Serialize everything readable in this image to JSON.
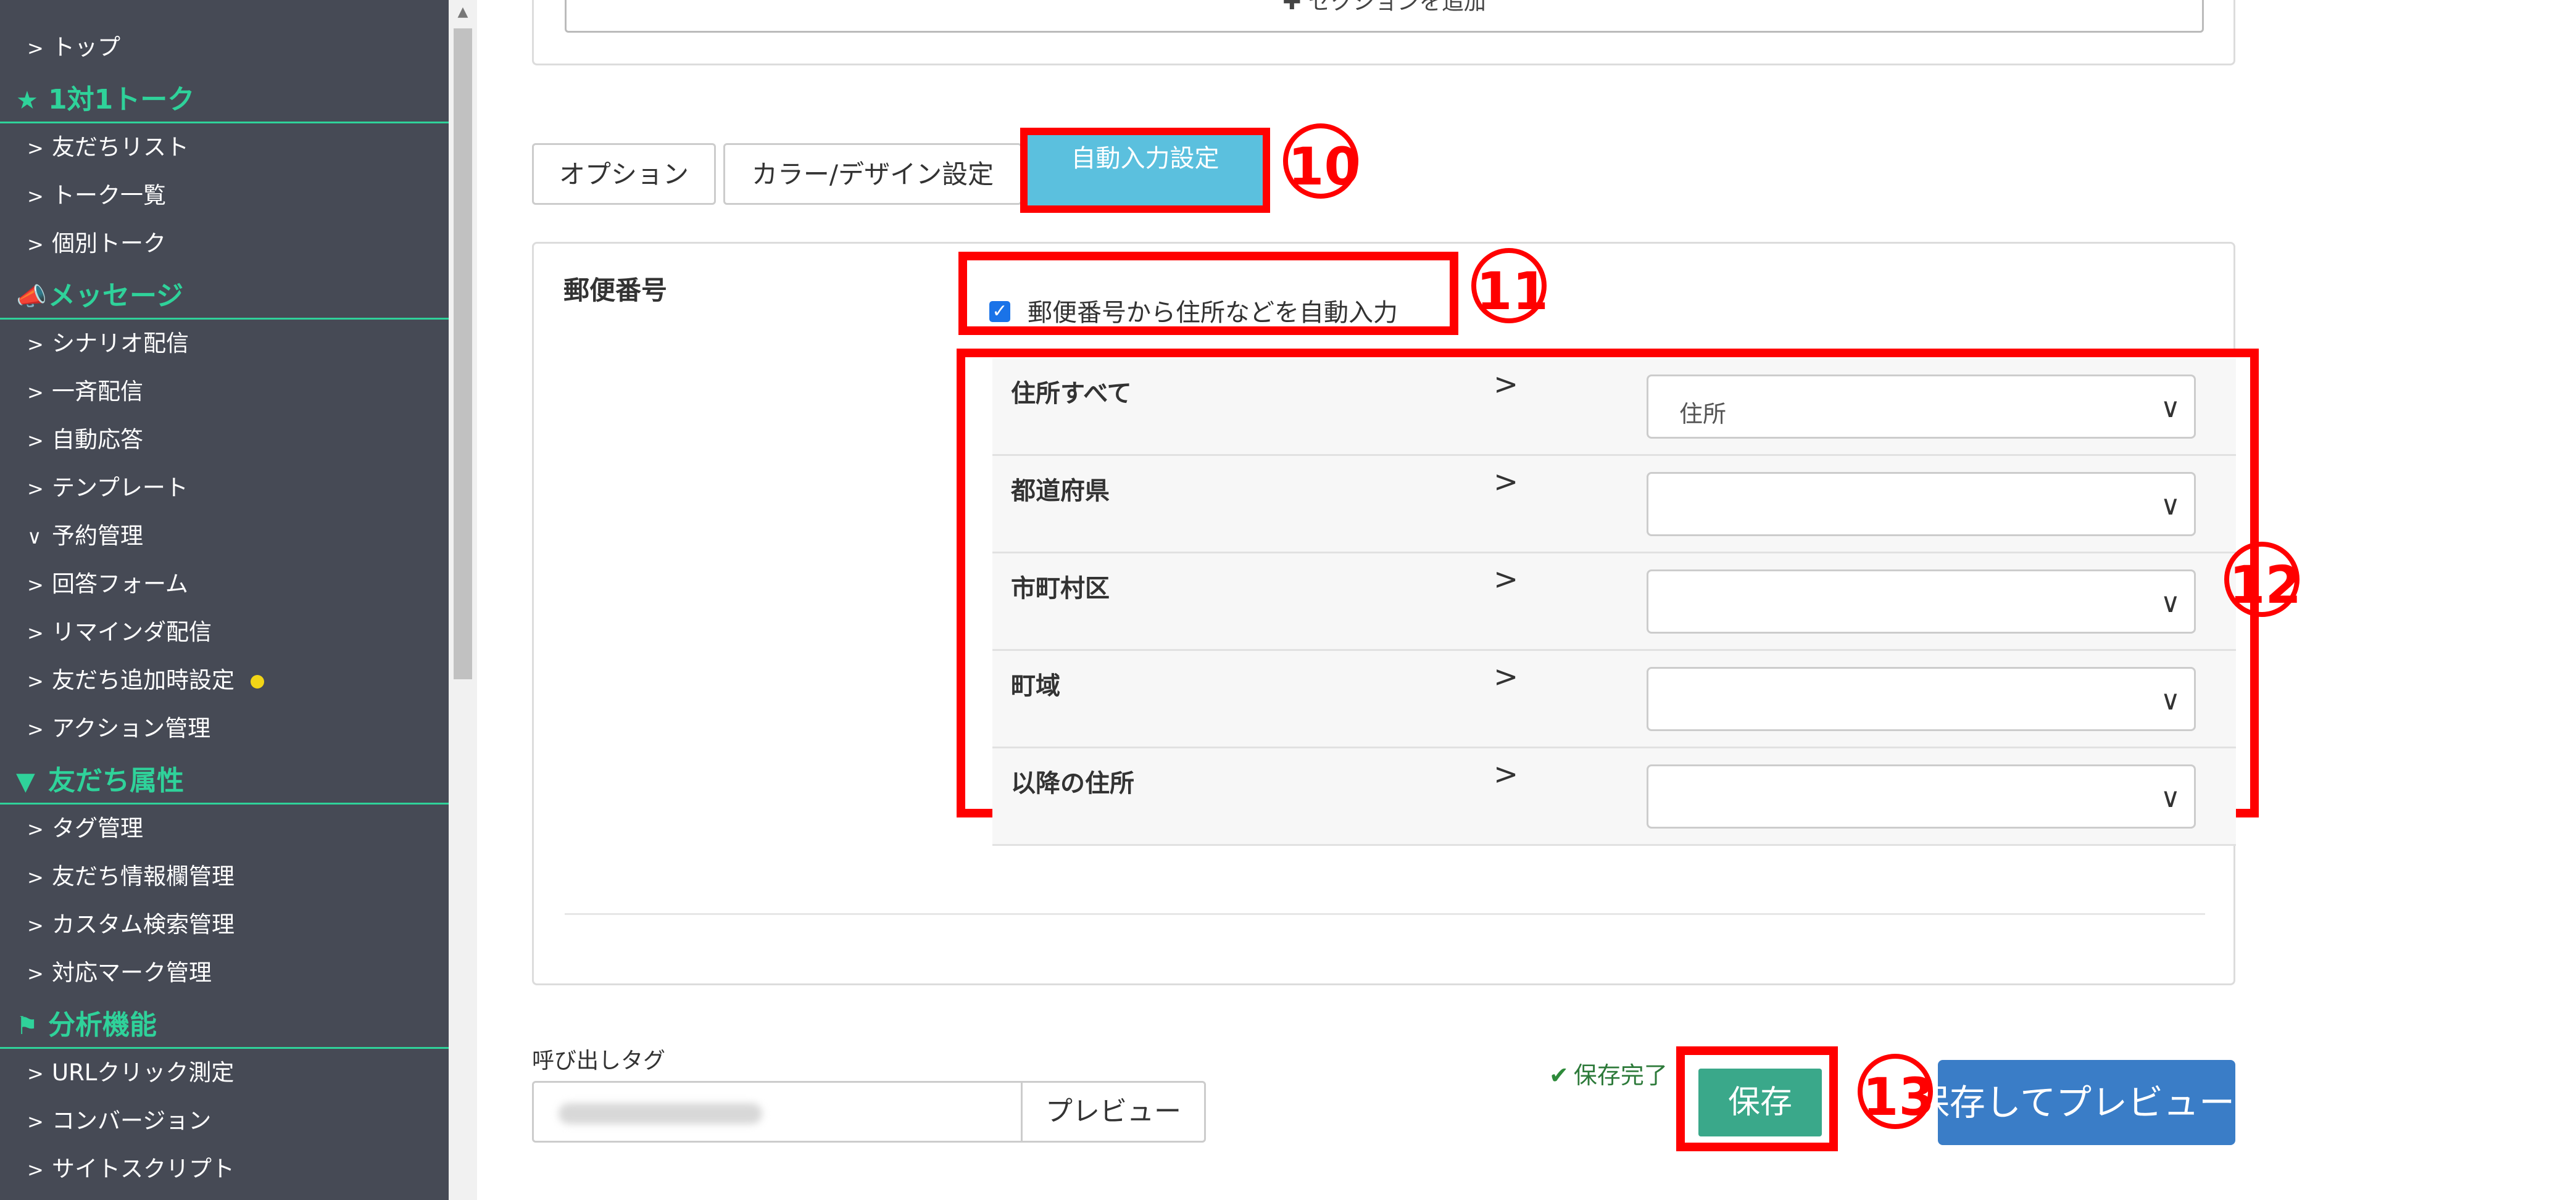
{
  "sidebar": {
    "items": [
      {
        "type": "item",
        "label": "トップ",
        "chevron": ">"
      },
      {
        "type": "section",
        "label": "1対1トーク",
        "icon": "star-icon",
        "glyph": "★"
      },
      {
        "type": "item",
        "label": "友だちリスト",
        "chevron": ">"
      },
      {
        "type": "item",
        "label": "トーク一覧",
        "chevron": ">"
      },
      {
        "type": "item",
        "label": "個別トーク",
        "chevron": ">"
      },
      {
        "type": "section",
        "label": "メッセージ",
        "icon": "megaphone-icon",
        "glyph": "📣"
      },
      {
        "type": "item",
        "label": "シナリオ配信",
        "chevron": ">"
      },
      {
        "type": "item",
        "label": "一斉配信",
        "chevron": ">"
      },
      {
        "type": "item",
        "label": "自動応答",
        "chevron": ">"
      },
      {
        "type": "item",
        "label": "テンプレート",
        "chevron": ">"
      },
      {
        "type": "item",
        "label": "予約管理",
        "chevron": "∨"
      },
      {
        "type": "item",
        "label": "回答フォーム",
        "chevron": ">"
      },
      {
        "type": "item",
        "label": "リマインダ配信",
        "chevron": ">"
      },
      {
        "type": "item",
        "label": "友だち追加時設定",
        "chevron": ">",
        "dot": true
      },
      {
        "type": "item",
        "label": "アクション管理",
        "chevron": ">"
      },
      {
        "type": "section",
        "label": "友だち属性",
        "icon": "filter-icon",
        "glyph": "▼"
      },
      {
        "type": "item",
        "label": "タグ管理",
        "chevron": ">"
      },
      {
        "type": "item",
        "label": "友だち情報欄管理",
        "chevron": ">"
      },
      {
        "type": "item",
        "label": "カスタム検索管理",
        "chevron": ">"
      },
      {
        "type": "item",
        "label": "対応マーク管理",
        "chevron": ">"
      },
      {
        "type": "section",
        "label": "分析機能",
        "icon": "flag-icon",
        "glyph": "⚑"
      },
      {
        "type": "item",
        "label": "URLクリック測定",
        "chevron": ">"
      },
      {
        "type": "item",
        "label": "コンバージョン",
        "chevron": ">"
      },
      {
        "type": "item",
        "label": "サイトスクリプト",
        "chevron": ">"
      }
    ]
  },
  "top_card": {
    "add_section_label": "✚ セクションを追加"
  },
  "tabs": [
    {
      "label": "オプション"
    },
    {
      "label": "カラー/デザイン設定"
    },
    {
      "label": "自動入力設定"
    }
  ],
  "annotations": {
    "a10": "10",
    "a11": "11",
    "a12": "12",
    "a13": "13"
  },
  "zip": {
    "label": "郵便番号",
    "checkbox_label": "郵便番号から住所などを自動入力",
    "checked": true
  },
  "mapping": {
    "arrow": ">",
    "chevron": "∨",
    "rows": [
      {
        "label": "住所すべて",
        "value": "住所"
      },
      {
        "label": "都道府県",
        "value": ""
      },
      {
        "label": "市町村区",
        "value": ""
      },
      {
        "label": "町域",
        "value": ""
      },
      {
        "label": "以降の住所",
        "value": ""
      }
    ]
  },
  "bottom": {
    "call_tag_label": "呼び出しタグ",
    "preview_label": "プレビュー",
    "save_status_check": "✔",
    "save_status": "保存完了",
    "save_label": "保存",
    "save_preview_label": "保存してプレビュー"
  },
  "colors": {
    "sidebar_bg": "#464a55",
    "sidebar_accent": "#2fd29a",
    "tab_active": "#5bc0de",
    "save_btn": "#3aa88a",
    "save_preview_btn": "#3a7dc7",
    "annotation": "#ff0000"
  }
}
